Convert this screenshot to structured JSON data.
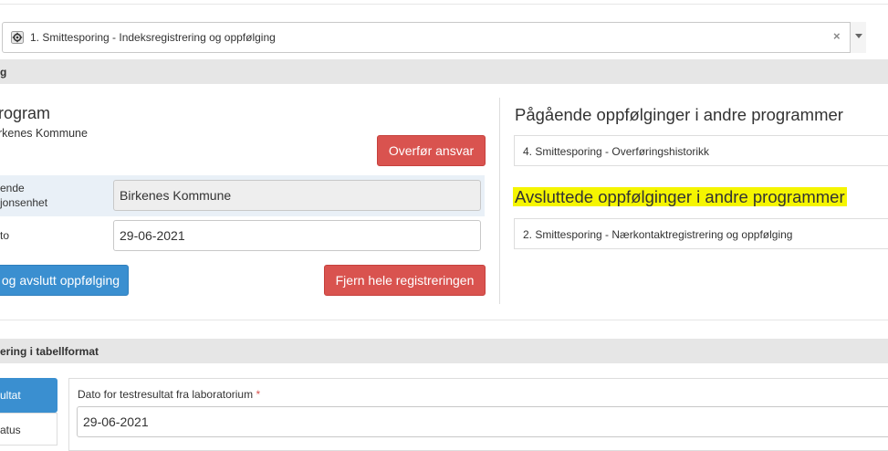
{
  "program_select": {
    "value": "1. Smittesporing - Indeksregistrering og oppfølging",
    "clear_icon": "×",
    "icon": "gear-icon"
  },
  "section1": {
    "title": "g"
  },
  "left": {
    "heading": "rogram",
    "subheading": "rkenes Kommune",
    "transfer_button": "Overfør ansvar",
    "org_label_line1": "ende",
    "org_label_line2": "jonsenhet",
    "org_value": "Birkenes Kommune",
    "date_label": "to",
    "date_value": "29-06-2021",
    "complete_button": "og avslutt oppfølging",
    "remove_button": "Fjern hele registreringen"
  },
  "right": {
    "ongoing_heading": "Pågående oppfølginger i andre programmer",
    "ongoing_items": [
      "4. Smittesporing - Overføringshistorikk"
    ],
    "completed_heading": "Avsluttede oppfølginger i andre programmer",
    "completed_items": [
      "2. Smittesporing - Nærkontaktregistrering og oppfølging"
    ]
  },
  "section2": {
    "title": "ering i tabellformat"
  },
  "tabs": {
    "active": "ultat",
    "second": "atus"
  },
  "form": {
    "test_date_label": "Dato for testresultat fra laboratorium",
    "required_mark": "*",
    "test_date_value": "29-06-2021"
  },
  "colors": {
    "danger": "#d9534f",
    "primary": "#3a8fd0",
    "highlight": "#f5f500",
    "section_bg": "#e6e6e6"
  }
}
